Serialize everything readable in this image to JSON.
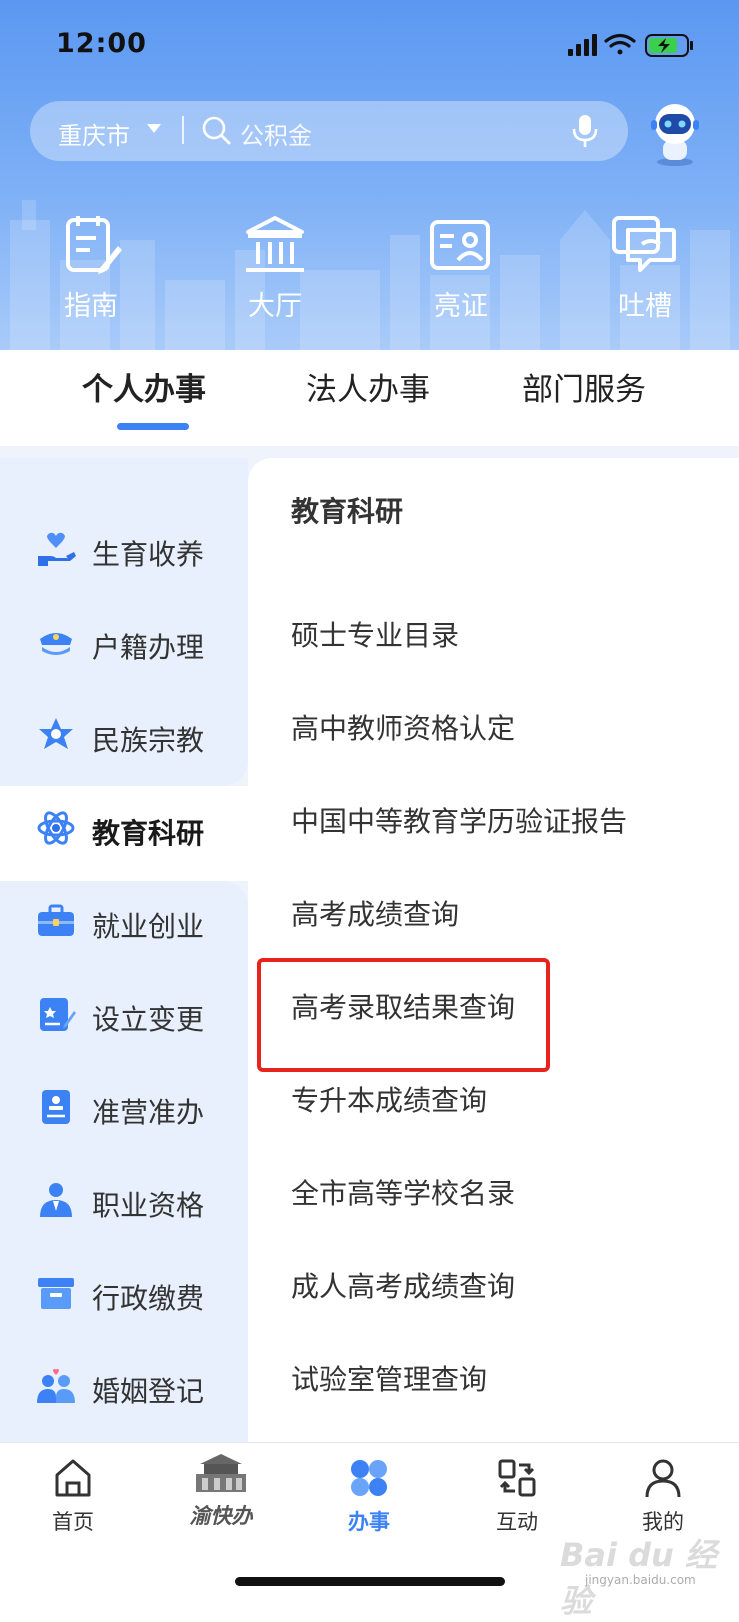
{
  "status_bar": {
    "time": "12:00"
  },
  "search": {
    "city": "重庆市",
    "placeholder": "公积金"
  },
  "quick_actions": [
    {
      "label": "指南",
      "icon": "guide-icon"
    },
    {
      "label": "大厅",
      "icon": "hall-icon"
    },
    {
      "label": "亮证",
      "icon": "id-card-icon"
    },
    {
      "label": "吐槽",
      "icon": "feedback-icon"
    }
  ],
  "tabs": [
    {
      "label": "个人办事",
      "active": true
    },
    {
      "label": "法人办事",
      "active": false
    },
    {
      "label": "部门服务",
      "active": false
    }
  ],
  "sidebar": {
    "items": [
      {
        "label": "生育收养",
        "icon": "hand-heart-icon"
      },
      {
        "label": "户籍办理",
        "icon": "police-cap-icon"
      },
      {
        "label": "民族宗教",
        "icon": "star-emblem-icon"
      },
      {
        "label": "教育科研",
        "icon": "atom-icon",
        "active": true
      },
      {
        "label": "就业创业",
        "icon": "briefcase-icon"
      },
      {
        "label": "设立变更",
        "icon": "edit-document-icon"
      },
      {
        "label": "准营准办",
        "icon": "permit-document-icon"
      },
      {
        "label": "职业资格",
        "icon": "professional-person-icon"
      },
      {
        "label": "行政缴费",
        "icon": "archive-box-icon"
      },
      {
        "label": "婚姻登记",
        "icon": "couple-icon"
      }
    ]
  },
  "section": {
    "title": "教育科研",
    "services": [
      "硕士专业目录",
      "高中教师资格认定",
      "中国中等教育学历验证报告",
      "高考成绩查询",
      "高考录取结果查询",
      "专升本成绩查询",
      "全市高等学校名录",
      "成人高考成绩查询",
      "试验室管理查询"
    ]
  },
  "bottom_nav": [
    {
      "label": "首页",
      "icon": "home-icon"
    },
    {
      "label": "渝快办",
      "icon": "yukuaiban-logo"
    },
    {
      "label": "办事",
      "icon": "services-grid-icon",
      "active": true
    },
    {
      "label": "互动",
      "icon": "interact-icon"
    },
    {
      "label": "我的",
      "icon": "profile-icon"
    }
  ],
  "watermark": {
    "text": "Bai du 经验",
    "sub": "jingyan.baidu.com"
  },
  "colors": {
    "accent": "#3d82f5",
    "highlight_border": "#e8231d",
    "sidebar_bg": "#e8f0fd"
  }
}
